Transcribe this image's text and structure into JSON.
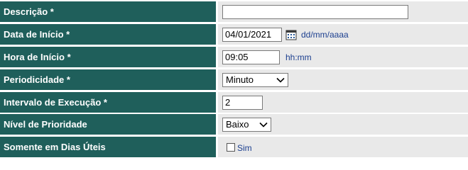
{
  "fields": {
    "descricao": {
      "label": "Descrição *",
      "value": ""
    },
    "data_inicio": {
      "label": "Data de Início *",
      "value": "04/01/2021",
      "hint": "dd/mm/aaaa",
      "icon": "calendar-icon"
    },
    "hora_inicio": {
      "label": "Hora de Início *",
      "value": "09:05",
      "hint": "hh:mm"
    },
    "periodicidade": {
      "label": "Periodicidade *",
      "selected": "Minuto"
    },
    "intervalo": {
      "label": "Intervalo de Execução *",
      "value": "2"
    },
    "prioridade": {
      "label": "Nível de Prioridade",
      "selected": "Baixo"
    },
    "dias_uteis": {
      "label": "Somente em Dias Úteis",
      "checkbox_label": "Sim",
      "checked": false
    }
  },
  "colors": {
    "label_bg": "#1f5f5b",
    "value_bg": "#e9e9e9",
    "hint_text": "#1c3f8f"
  }
}
